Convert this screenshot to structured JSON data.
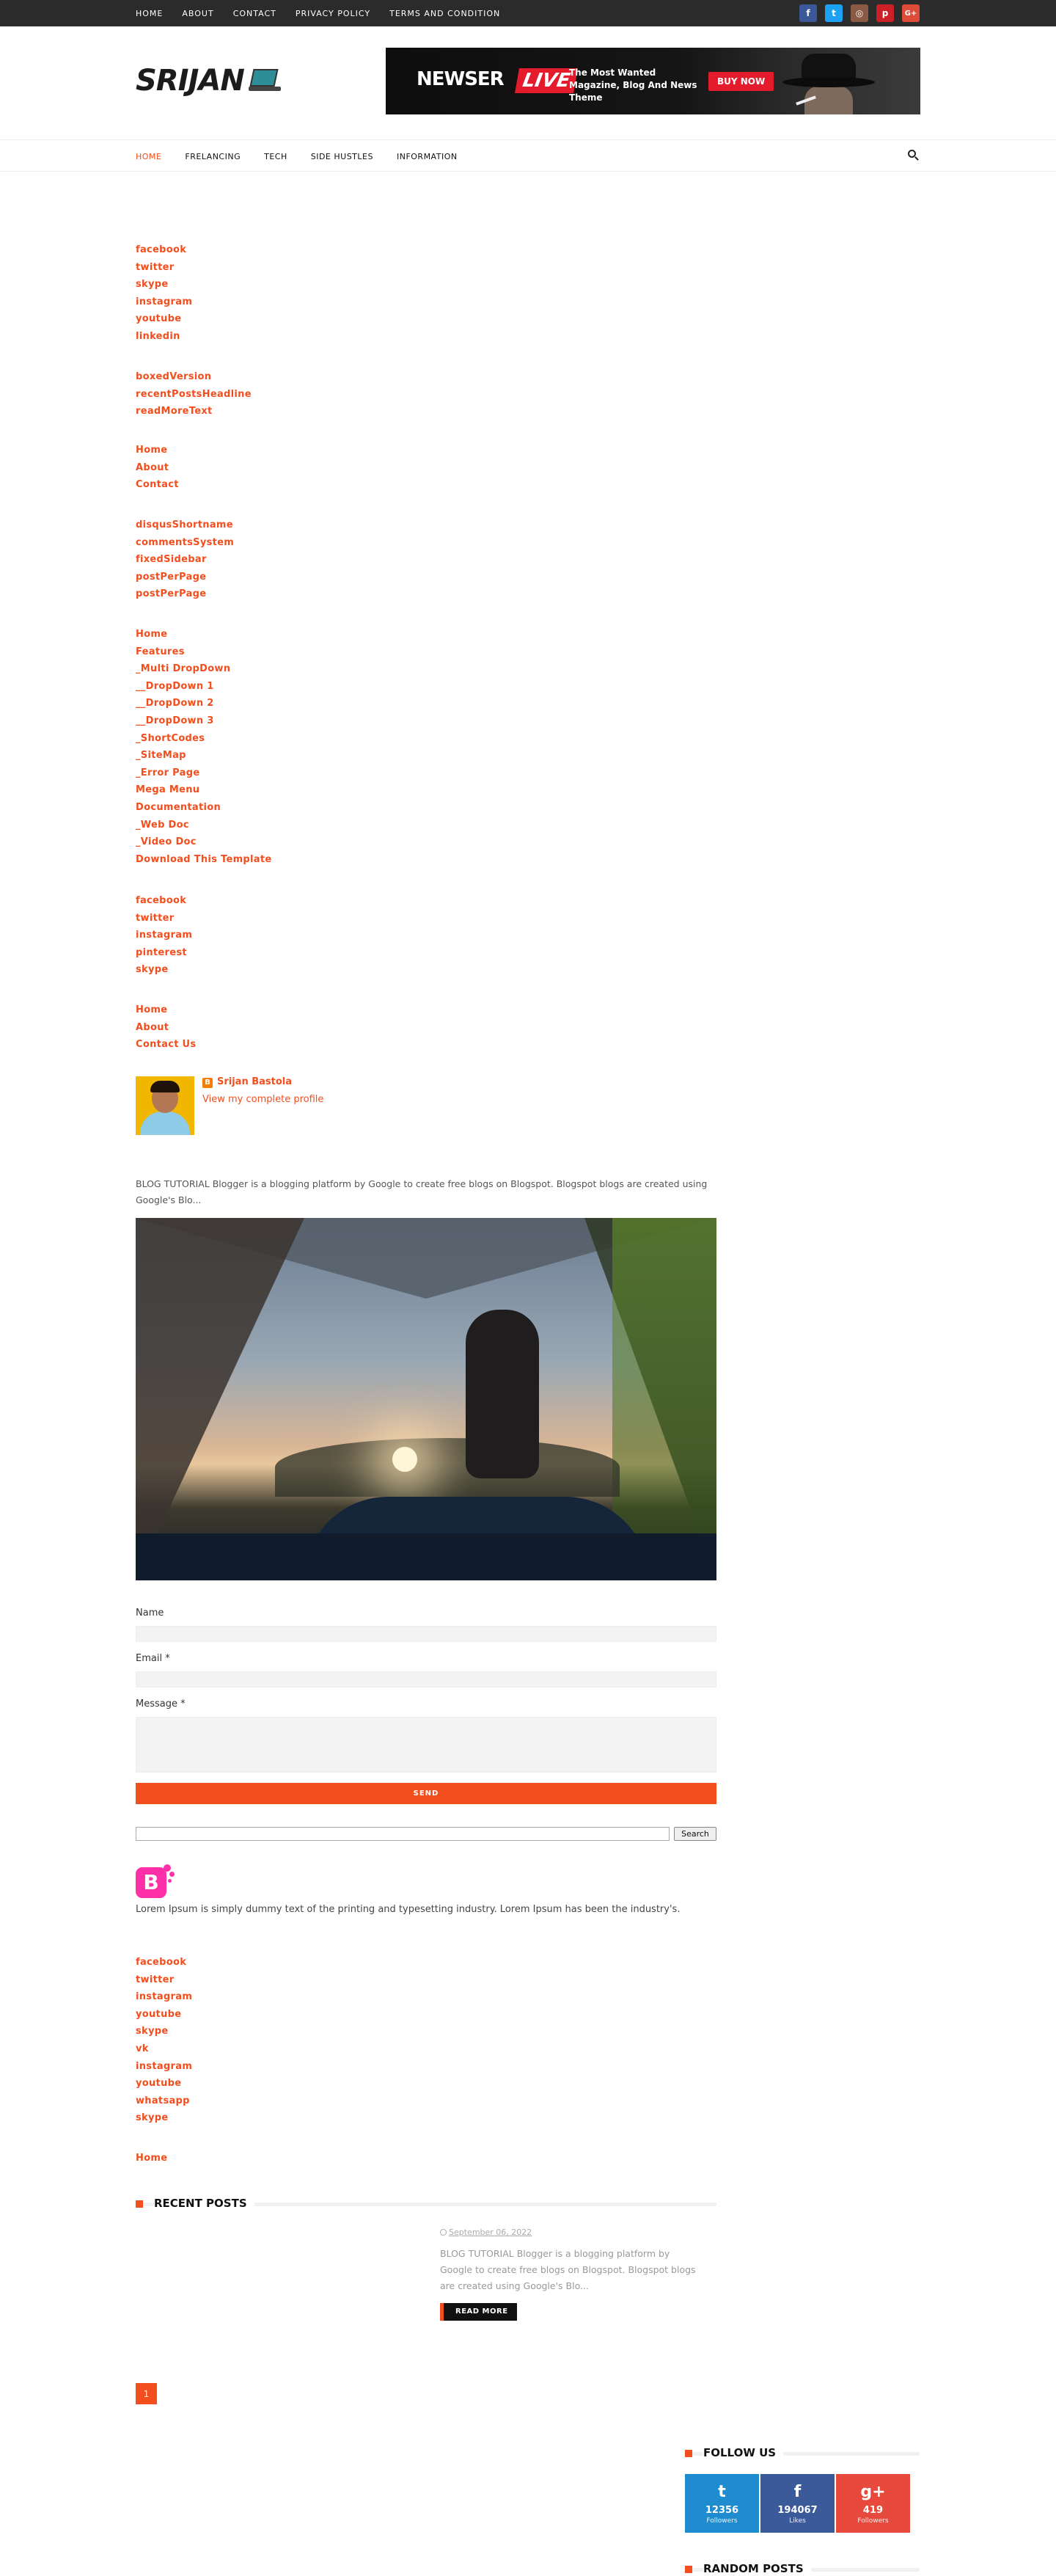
{
  "top_nav": [
    "HOME",
    "ABOUT",
    "CONTACT",
    "PRIVACY POLICY",
    "TERMS AND CONDITION"
  ],
  "top_socials": [
    {
      "icon": "facebook-icon",
      "glyph": "f",
      "color": "#3b5998"
    },
    {
      "icon": "twitter-icon",
      "glyph": "t",
      "color": "#1da1f2"
    },
    {
      "icon": "instagram-icon",
      "glyph": "◎",
      "color": "#8a5a44"
    },
    {
      "icon": "pinterest-icon",
      "glyph": "p",
      "color": "#cb2027"
    },
    {
      "icon": "google-plus-icon",
      "glyph": "G+",
      "color": "#dd4b39"
    }
  ],
  "logo": {
    "text": "SRIJAN"
  },
  "banner": {
    "brand_a": "NEWSER",
    "brand_b": "LIVE",
    "tagline": "The Most Wanted Magazine, Blog And News Theme",
    "cta": "BUY NOW"
  },
  "main_nav": {
    "items": [
      "HOME",
      "FRELANCING",
      "TECH",
      "SIDE HUSTLES",
      "INFORMATION"
    ],
    "active_index": 0
  },
  "link_groups": [
    [
      "facebook",
      "twitter",
      "skype",
      "instagram",
      "youtube",
      "linkedin"
    ],
    [
      "boxedVersion",
      "recentPostsHeadline",
      "readMoreText"
    ],
    [
      "Home",
      "About",
      "Contact"
    ],
    [
      "disqusShortname",
      "commentsSystem",
      "fixedSidebar",
      "postPerPage",
      "postPerPage"
    ],
    [
      "Home",
      "Features",
      "_Multi DropDown",
      "__DropDown 1",
      "__DropDown 2",
      "__DropDown 3",
      "_ShortCodes",
      "_SiteMap",
      "_Error Page",
      "Mega Menu",
      "Documentation",
      "_Web Doc",
      "_Video Doc",
      "Download This Template"
    ],
    [
      "facebook",
      "twitter",
      "instagram",
      "pinterest",
      "skype"
    ],
    [
      "Home",
      "About",
      "Contact Us"
    ]
  ],
  "profile": {
    "name": "Srijan Bastola",
    "link": "View my complete profile"
  },
  "blog_tutorial": "BLOG TUTORIAL   Blogger is a blogging platform by Google to create free blogs on Blogspot. Blogspot blogs are created using Google's Blo...",
  "contact_form": {
    "name_label": "Name",
    "email_label": "Email",
    "message_label": "Message",
    "required_mark": "*",
    "send_label": "SEND"
  },
  "search": {
    "button_label": "Search"
  },
  "blogger_logo": {
    "letter": "B"
  },
  "about_text": "Lorem Ipsum is simply dummy text of the printing and typesetting industry. Lorem Ipsum has been the industry's.",
  "link_groups_2": [
    [
      "facebook",
      "twitter",
      "instagram",
      "youtube",
      "skype",
      "vk",
      "instagram",
      "youtube",
      "whatsapp",
      "skype"
    ],
    [
      "Home"
    ]
  ],
  "recent_posts": {
    "title": "RECENT POSTS",
    "post": {
      "date": "September 06, 2022",
      "excerpt": "BLOG TUTORIAL  Blogger is a blogging platform by Google to create free blogs on Blogspot. Blogspot blogs are created using Google's Blo...",
      "read_more": "READ MORE"
    }
  },
  "pagination": {
    "current": "1"
  },
  "follow_us": {
    "title": "FOLLOW US",
    "boxes": [
      {
        "icon": "twitter-icon",
        "glyph": "t",
        "count": "12356",
        "label": "Followers",
        "color": "#1f8ccf"
      },
      {
        "icon": "facebook-icon",
        "glyph": "f",
        "count": "194067",
        "label": "Likes",
        "color": "#3b5a9a"
      },
      {
        "icon": "google-plus-icon",
        "glyph": "g+",
        "count": "419",
        "label": "Followers",
        "color": "#e8493d"
      }
    ]
  },
  "random_posts": {
    "title": "RANDOM POSTS"
  },
  "colors": {
    "accent": "#f24e1e",
    "topbar": "#2b2b2b"
  }
}
